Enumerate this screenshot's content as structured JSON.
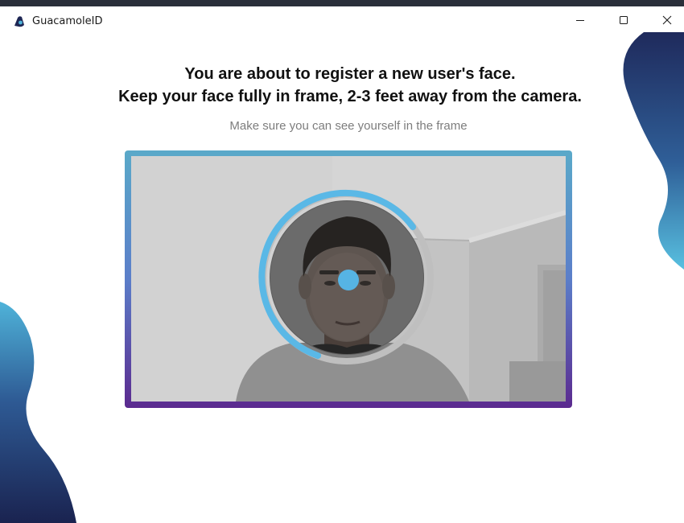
{
  "window": {
    "title": "GuacamoleID",
    "controls": {
      "minimize_icon": "minimize-icon",
      "maximize_icon": "maximize-icon",
      "close_icon": "close-icon"
    }
  },
  "main": {
    "heading_line1": "You are about to register a new user's face.",
    "heading_line2": "Keep your face fully in frame, 2-3 feet away from the camera.",
    "instruction": "Make sure you can see yourself in the frame"
  },
  "camera": {
    "progress_ring_color": "#5ab8e6",
    "frame_gradient_top": "#5aa9c9",
    "frame_gradient_bottom": "#5b2a8f",
    "face_marker_color": "#56b4e4"
  },
  "colors": {
    "blob_dark": "#1f2a5c",
    "blob_light": "#4fb3d9"
  }
}
